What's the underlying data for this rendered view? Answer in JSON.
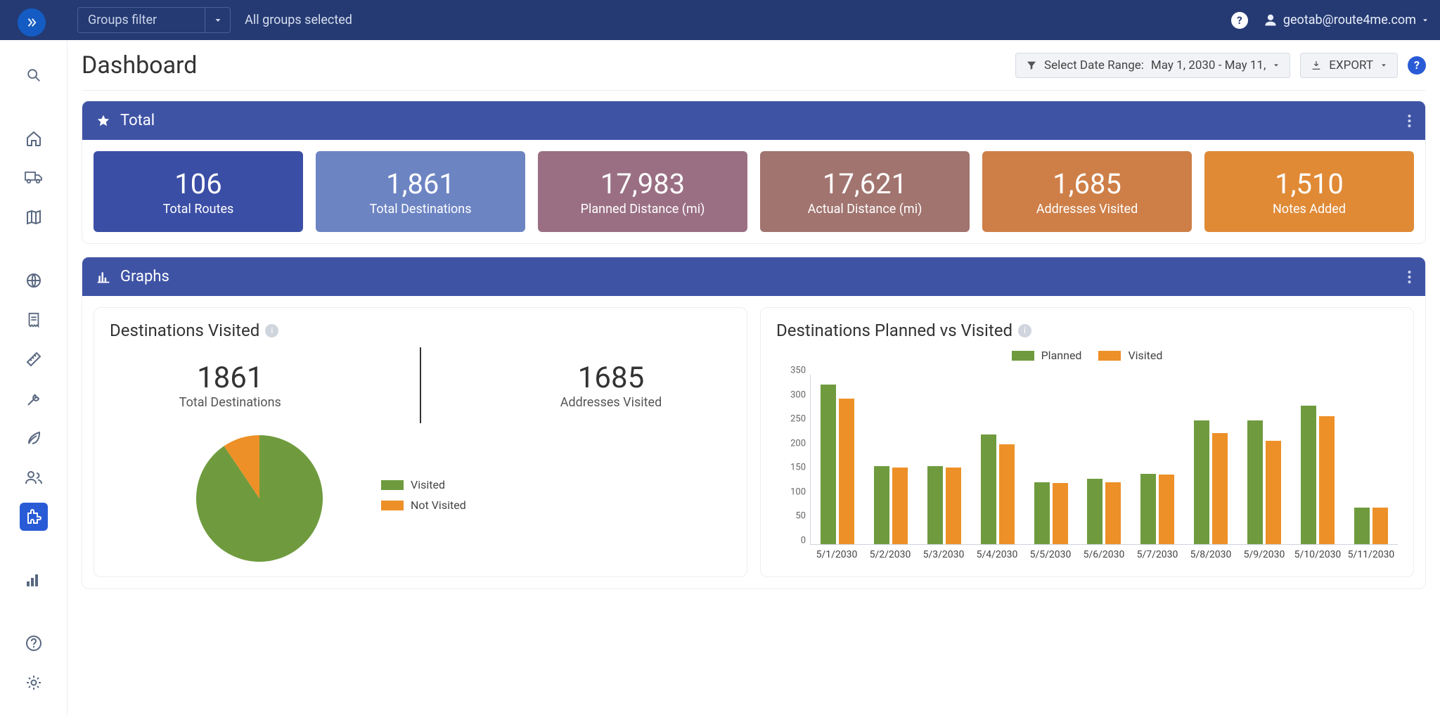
{
  "colors": {
    "green": "#6f9b3e",
    "orange": "#ed9028",
    "topbar": "#253a72",
    "panel": "#3f53a5"
  },
  "topbar": {
    "groups_filter_label": "Groups filter",
    "all_groups": "All groups selected",
    "user_email": "geotab@route4me.com"
  },
  "header": {
    "title": "Dashboard",
    "date_label": "Select Date Range:",
    "date_value": "May 1, 2030 - May 11,",
    "export_label": "EXPORT"
  },
  "total_panel": {
    "title": "Total",
    "stats": [
      {
        "value": "106",
        "label": "Total Routes",
        "bg": "#3b4ea6"
      },
      {
        "value": "1,861",
        "label": "Total Destinations",
        "bg": "#6d84c3"
      },
      {
        "value": "17,983",
        "label": "Planned Distance (mi)",
        "bg": "#9a6f83"
      },
      {
        "value": "17,621",
        "label": "Actual Distance (mi)",
        "bg": "#a1746f"
      },
      {
        "value": "1,685",
        "label": "Addresses Visited",
        "bg": "#ce7f48"
      },
      {
        "value": "1,510",
        "label": "Notes Added",
        "bg": "#e08a36"
      }
    ]
  },
  "graphs_panel": {
    "title": "Graphs"
  },
  "donut_card": {
    "title": "Destinations Visited",
    "total_value": "1861",
    "total_label": "Total Destinations",
    "visited_value": "1685",
    "visited_label": "Addresses Visited",
    "legend_visited": "Visited",
    "legend_not_visited": "Not Visited"
  },
  "bar_card": {
    "title": "Destinations Planned vs Visited",
    "legend_planned": "Planned",
    "legend_visited": "Visited"
  },
  "chart_data": [
    {
      "type": "pie",
      "title": "Destinations Visited",
      "series": [
        {
          "name": "Visited",
          "value": 1685,
          "color": "#6f9b3e"
        },
        {
          "name": "Not Visited",
          "value": 176,
          "color": "#ed9028"
        }
      ],
      "total": 1861
    },
    {
      "type": "bar",
      "title": "Destinations Planned vs Visited",
      "categories": [
        "5/1/2030",
        "5/2/2030",
        "5/3/2030",
        "5/4/2030",
        "5/5/2030",
        "5/6/2030",
        "5/7/2030",
        "5/8/2030",
        "5/9/2030",
        "5/10/2030",
        "5/11/2030"
      ],
      "series": [
        {
          "name": "Planned",
          "color": "#6f9b3e",
          "values": [
            328,
            160,
            160,
            225,
            128,
            135,
            145,
            255,
            255,
            285,
            75
          ]
        },
        {
          "name": "Visited",
          "color": "#ed9028",
          "values": [
            300,
            158,
            158,
            205,
            126,
            128,
            143,
            228,
            212,
            263,
            75
          ]
        }
      ],
      "ylabel": "",
      "xlabel": "",
      "ylim": [
        0,
        350
      ],
      "y_ticks": [
        0,
        50,
        100,
        150,
        200,
        250,
        300,
        350
      ]
    }
  ]
}
